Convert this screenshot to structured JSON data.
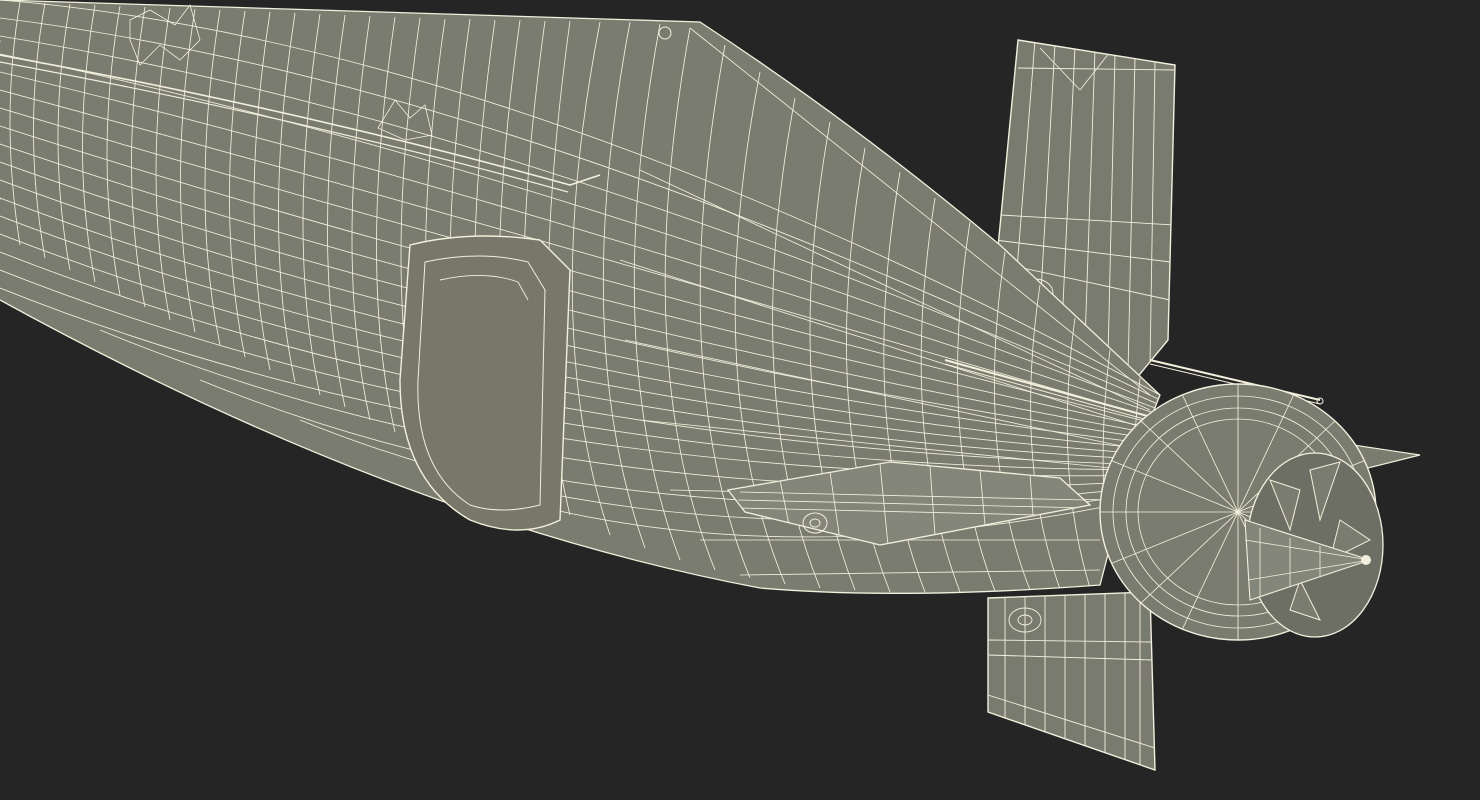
{
  "scene": {
    "subject": "submarine-stern-wireframe",
    "render_style": "wireframe",
    "colors": {
      "background": "#252525",
      "surface": "#7b7c70",
      "surface_light": "#85867a",
      "surface_dark": "#6e6f64",
      "wire": "#f2f0dc"
    }
  }
}
